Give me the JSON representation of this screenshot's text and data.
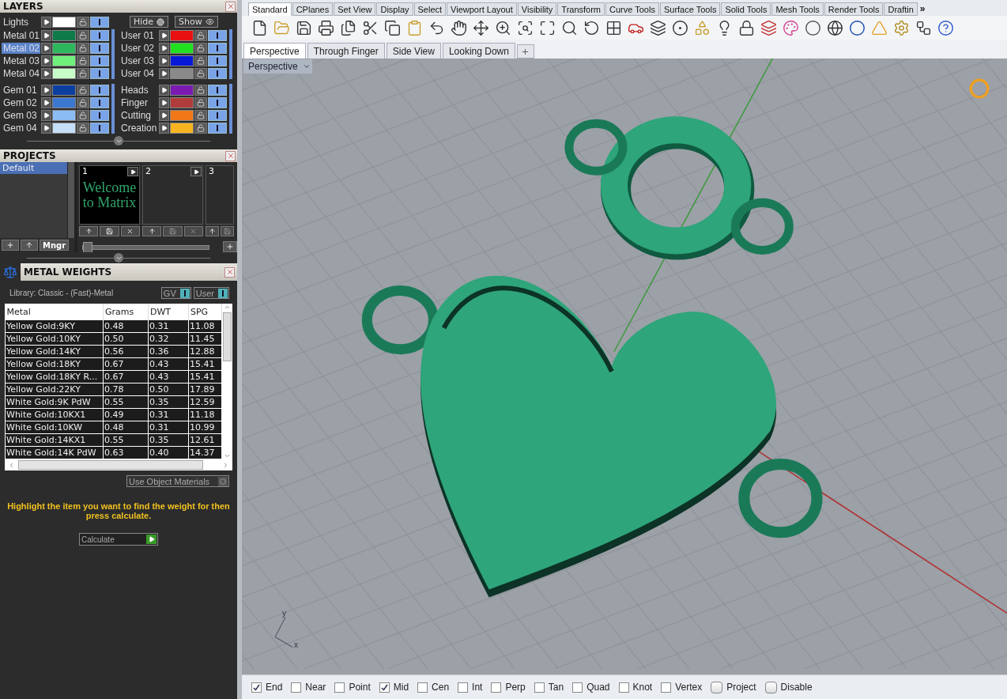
{
  "layers": {
    "title": "LAYERS",
    "lights": {
      "name": "Lights",
      "color": "#ffffff",
      "visible": true
    },
    "hide": "Hide",
    "show": "Show",
    "columns": [
      {
        "groups": [
          [
            {
              "name": "Metal 01",
              "color": "#0f7a4a",
              "selected": false,
              "visible": true
            },
            {
              "name": "Metal 02",
              "color": "#2db85e",
              "selected": true,
              "visible": true
            },
            {
              "name": "Metal 03",
              "color": "#6ef07a",
              "selected": false,
              "visible": true
            },
            {
              "name": "Metal 04",
              "color": "#c8fcc8",
              "selected": false,
              "visible": true
            }
          ],
          [
            {
              "name": "Gem 01",
              "color": "#0b3fa0",
              "selected": false,
              "visible": true
            },
            {
              "name": "Gem 02",
              "color": "#3c78d0",
              "selected": false,
              "visible": true
            },
            {
              "name": "Gem 03",
              "color": "#8cbcf4",
              "selected": false,
              "visible": true
            },
            {
              "name": "Gem 04",
              "color": "#c4def8",
              "selected": false,
              "visible": true
            }
          ]
        ]
      },
      {
        "groups": [
          [
            {
              "name": "User 01",
              "color": "#e81010",
              "selected": false,
              "visible": true
            },
            {
              "name": "User 02",
              "color": "#20e020",
              "selected": false,
              "visible": true
            },
            {
              "name": "User 03",
              "color": "#0818d8",
              "selected": false,
              "visible": true
            },
            {
              "name": "User 04",
              "color": "#8a8a8a",
              "selected": false,
              "visible": true
            }
          ],
          [
            {
              "name": "Heads",
              "color": "#7a1ab0",
              "selected": false,
              "visible": true
            },
            {
              "name": "Finger",
              "color": "#b03c3c",
              "selected": false,
              "visible": true
            },
            {
              "name": "Cutting",
              "color": "#f07818",
              "selected": false,
              "visible": true
            },
            {
              "name": "Creation",
              "color": "#f8b420",
              "selected": false,
              "visible": true
            }
          ]
        ]
      }
    ]
  },
  "projects": {
    "title": "PROJECTS",
    "list": [
      {
        "name": "Default",
        "selected": true
      }
    ],
    "manager": "Mngr",
    "slider": {
      "level": 0
    },
    "slots": [
      {
        "kind": "full",
        "number": "1",
        "thumbnail": "Welcome to Matrix"
      },
      {
        "kind": "full",
        "number": "2"
      },
      {
        "kind": "partial",
        "number": "3"
      }
    ]
  },
  "metal_weights": {
    "title": "METAL WEIGHTS",
    "library": "Library: Classic - (Fast)-Metal",
    "toggles": [
      {
        "label": "GV",
        "on": true
      },
      {
        "label": "User",
        "on": true
      }
    ],
    "table": {
      "columns": [
        "Metal",
        "Grams",
        "DWT",
        "SPG"
      ],
      "rows": [
        [
          "Yellow Gold:9KY",
          "0.48",
          "0.31",
          "11.08"
        ],
        [
          "Yellow Gold:10KY",
          "0.50",
          "0.32",
          "11.45"
        ],
        [
          "Yellow Gold:14KY",
          "0.56",
          "0.36",
          "12.88"
        ],
        [
          "Yellow Gold:18KY",
          "0.67",
          "0.43",
          "15.41"
        ],
        [
          "Yellow Gold:18KY R...",
          "0.67",
          "0.43",
          "15.41"
        ],
        [
          "Yellow Gold:22KY",
          "0.78",
          "0.50",
          "17.89"
        ],
        [
          "White Gold:9K PdW",
          "0.55",
          "0.35",
          "12.59"
        ],
        [
          "White Gold:10KX1",
          "0.49",
          "0.31",
          "11.18"
        ],
        [
          "White Gold:10KW",
          "0.48",
          "0.31",
          "10.99"
        ],
        [
          "White Gold:14KX1",
          "0.55",
          "0.35",
          "12.61"
        ],
        [
          "White Gold:14K PdW",
          "0.63",
          "0.40",
          "14.37"
        ]
      ]
    },
    "use_object_materials": {
      "label": "Use Object Materials",
      "on": false
    },
    "hint": "Highlight the item you want to find the weight for then press calculate.",
    "calculate": "Calculate"
  },
  "toolbar_tabs": [
    {
      "label": "Standard",
      "selected": true
    },
    {
      "label": "CPlanes",
      "selected": false
    },
    {
      "label": "Set View",
      "selected": false
    },
    {
      "label": "Display",
      "selected": false
    },
    {
      "label": "Select",
      "selected": false
    },
    {
      "label": "Viewport Layout",
      "selected": false
    },
    {
      "label": "Visibility",
      "selected": false
    },
    {
      "label": "Transform",
      "selected": false
    },
    {
      "label": "Curve Tools",
      "selected": false
    },
    {
      "label": "Surface Tools",
      "selected": false
    },
    {
      "label": "Solid Tools",
      "selected": false
    },
    {
      "label": "Mesh Tools",
      "selected": false
    },
    {
      "label": "Render Tools",
      "selected": false
    },
    {
      "label": "Draftin",
      "selected": false
    }
  ],
  "more_tabs": "»",
  "viewport_tabs": [
    {
      "label": "Perspective",
      "selected": true
    },
    {
      "label": "Through Finger",
      "selected": false
    },
    {
      "label": "Side View",
      "selected": false
    },
    {
      "label": "Looking Down",
      "selected": false
    }
  ],
  "viewport": {
    "title": "Perspective",
    "axis_x": "x",
    "axis_y": "y"
  },
  "osnaps": [
    {
      "kind": "check",
      "label": "End",
      "checked": true
    },
    {
      "kind": "check",
      "label": "Near",
      "checked": false
    },
    {
      "kind": "check",
      "label": "Point",
      "checked": false
    },
    {
      "kind": "check",
      "label": "Mid",
      "checked": true
    },
    {
      "kind": "check",
      "label": "Cen",
      "checked": false
    },
    {
      "kind": "check",
      "label": "Int",
      "checked": false
    },
    {
      "kind": "check",
      "label": "Perp",
      "checked": false
    },
    {
      "kind": "check",
      "label": "Tan",
      "checked": false
    },
    {
      "kind": "check",
      "label": "Quad",
      "checked": false
    },
    {
      "kind": "check",
      "label": "Knot",
      "checked": false
    },
    {
      "kind": "check",
      "label": "Vertex",
      "checked": false
    },
    {
      "kind": "button",
      "label": "Project",
      "checked": false
    },
    {
      "kind": "button",
      "label": "Disable",
      "checked": false
    }
  ]
}
